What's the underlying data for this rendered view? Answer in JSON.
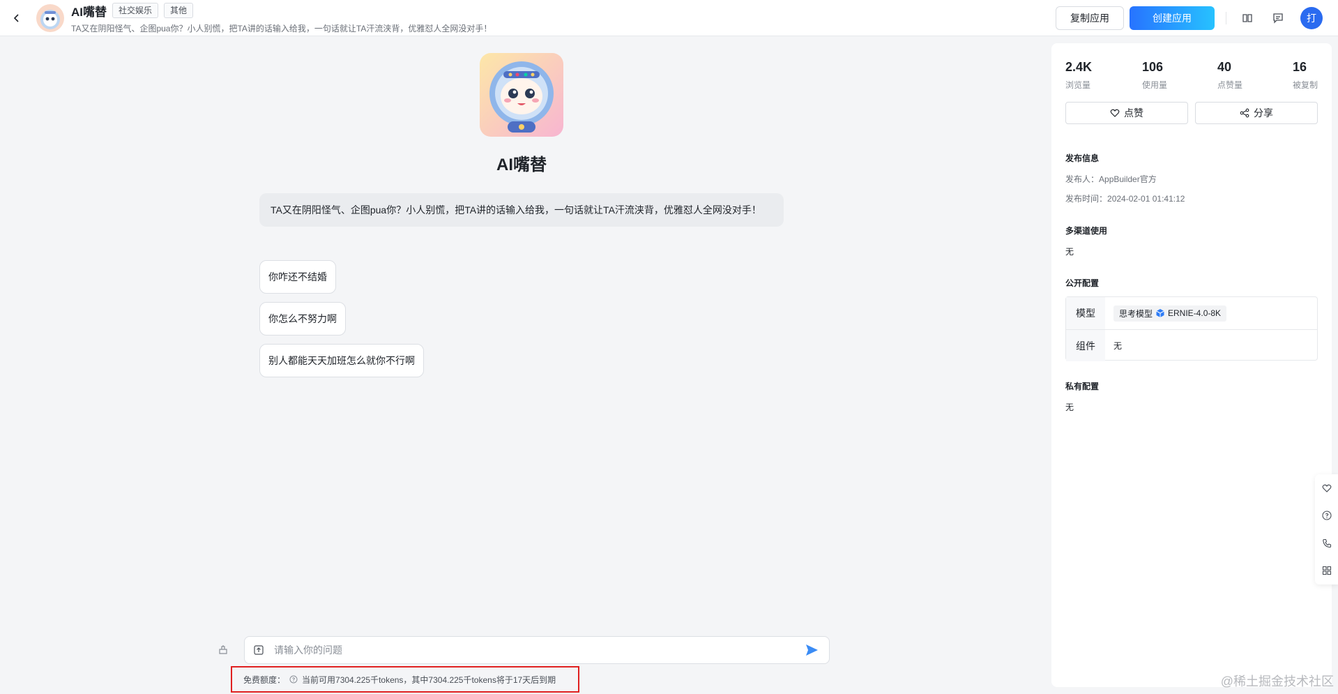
{
  "header": {
    "app_name": "AI嘴替",
    "tags": [
      "社交娱乐",
      "其他"
    ],
    "description": "TA又在阴阳怪气、企图pua你？小人别慌，把TA讲的话输入给我，一句话就让TA汗流浃背，优雅怼人全网没对手！",
    "copy_label": "复制应用",
    "create_label": "创建应用",
    "user_initial": "打"
  },
  "chat": {
    "bot_name": "AI嘴替",
    "intro": "TA又在阴阳怪气、企图pua你？小人别慌，把TA讲的话输入给我，一句话就让TA汗流浃背，优雅怼人全网没对手！",
    "suggestions": [
      "你咋还不结婚",
      "你怎么不努力啊",
      "别人都能天天加班怎么就你不行啊"
    ],
    "input_placeholder": "请输入你的问题",
    "quota_label": "免费额度：",
    "quota_text": "当前可用7304.225千tokens，其中7304.225千tokens将于17天后到期"
  },
  "panel": {
    "stats": [
      {
        "value": "2.4K",
        "label": "浏览量"
      },
      {
        "value": "106",
        "label": "使用量"
      },
      {
        "value": "40",
        "label": "点赞量"
      },
      {
        "value": "16",
        "label": "被复制"
      }
    ],
    "like_label": "点赞",
    "share_label": "分享",
    "publish_title": "发布信息",
    "publisher_label": "发布人：",
    "publisher": "AppBuilder官方",
    "publish_time_label": "发布时间：",
    "publish_time": "2024-02-01 01:41:12",
    "channel_title": "多渠道使用",
    "channel_value": "无",
    "public_title": "公开配置",
    "model_key": "模型",
    "model_type": "思考模型",
    "model_name": "ERNIE-4.0-8K",
    "component_key": "组件",
    "component_value": "无",
    "private_title": "私有配置",
    "private_value": "无"
  },
  "credit": "@稀土掘金技术社区",
  "colors": {
    "accent": "#2773ff",
    "highlight_border": "#e02020"
  }
}
